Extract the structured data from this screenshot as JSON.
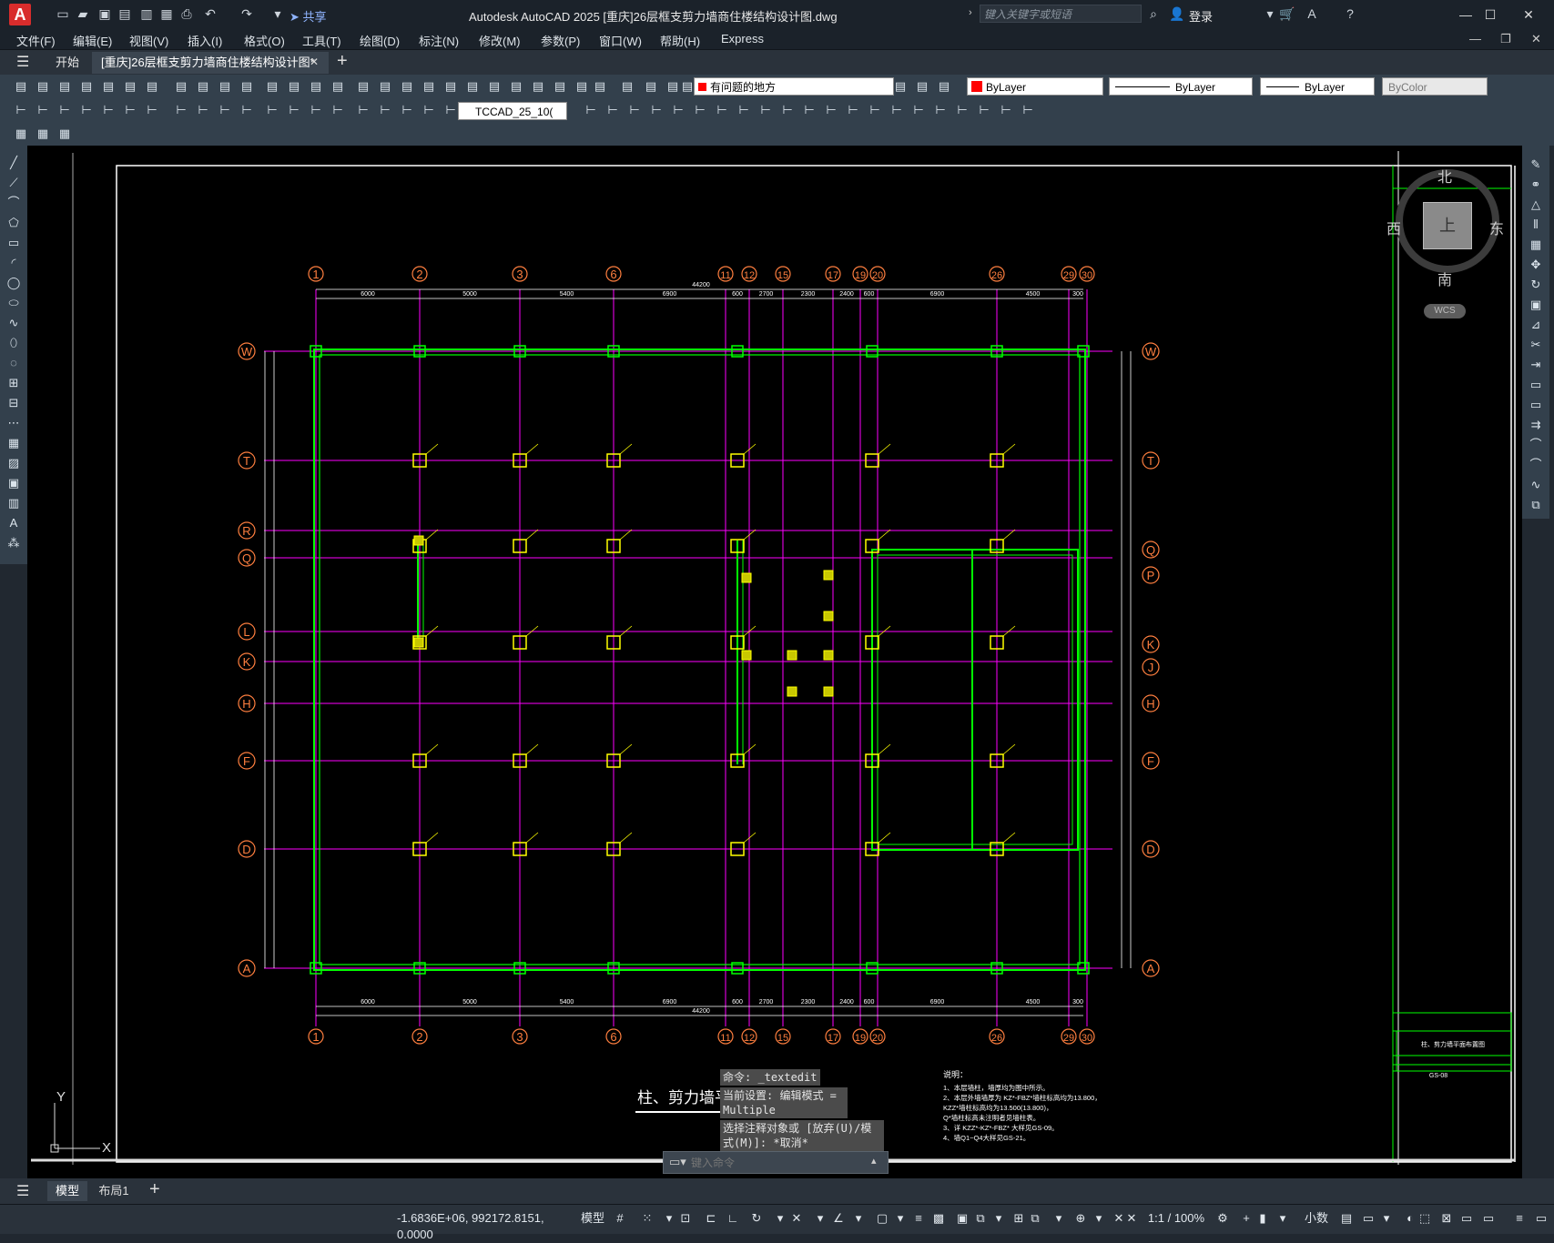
{
  "app": {
    "title": "Autodesk AutoCAD 2025    [重庆]26层框支剪力墙商住楼结构设计图.dwg",
    "logo": "A",
    "search_placeholder": "键入关键字或短语",
    "login": "登录",
    "share": "共享"
  },
  "menu": [
    "文件(F)",
    "编辑(E)",
    "视图(V)",
    "插入(I)",
    "格式(O)",
    "工具(T)",
    "绘图(D)",
    "标注(N)",
    "修改(M)",
    "参数(P)",
    "窗口(W)",
    "帮助(H)",
    "Express"
  ],
  "tabs": {
    "start": "开始",
    "document": "[重庆]26层框支剪力墙商住楼结构设计图*"
  },
  "toolbar": {
    "layer": "有问题的地方",
    "color": "ByLayer",
    "linetype": "ByLayer",
    "lineweight": "ByLayer",
    "plotstyle": "ByColor",
    "textstyle": "TCCAD_25_10("
  },
  "viewcube": {
    "north": "北",
    "south": "南",
    "east": "东",
    "west": "西",
    "top": "上",
    "wcs": "WCS"
  },
  "drawing": {
    "top_axes": [
      "1",
      "2",
      "3",
      "6",
      "11",
      "12",
      "15",
      "17",
      "19",
      "20",
      "26",
      "29",
      "30"
    ],
    "left_axes": [
      "W",
      "T",
      "R",
      "Q",
      "L",
      "K",
      "H",
      "F",
      "D",
      "A"
    ],
    "right_axes": [
      "W",
      "T",
      "Q",
      "P",
      "K",
      "J",
      "H",
      "F",
      "D",
      "A"
    ],
    "overall_dim": "44200",
    "top_dims": [
      "6000",
      "5000",
      "5400",
      "6900",
      "600",
      "2700",
      "2300",
      "2400",
      "600",
      "6900",
      "4500",
      "300"
    ],
    "plan_title": "柱、剪力墙平面布置图",
    "notes_title": "说明：",
    "notes": [
      "1、本层墙柱，墙厚均为图中所示。",
      "2、本层外墙墙厚为 KZ*-FBZ*墙柱标高均为13.800，",
      "    KZZ*墙柱标高均为13.500(13.800)，",
      "    Q*墙柱标高未注明者见墙柱表。",
      "3、详 KZZ*-KZ*-FBZ* 大样见GS-09。",
      "4、墙Q1~Q4大样见GS-21。"
    ],
    "titleblock_name": "柱、剪力墙平面布置图",
    "titleblock_no": "GS-08"
  },
  "command": {
    "line1": "命令: _textedit",
    "line2": "当前设置: 编辑模式 = Multiple",
    "line3": "选择注释对象或 [放弃(U)/模式(M)]: *取消*",
    "input_placeholder": "键入命令"
  },
  "layout_tabs": [
    "模型",
    "布局1"
  ],
  "status": {
    "coords": "-1.6836E+06, 992172.8151, 0.0000",
    "mode": "模型",
    "scale": "1:1 / 100%",
    "units": "小数"
  },
  "colors": {
    "grid": "#ff00ff",
    "wall": "#00ff00",
    "column": "#ffff00",
    "bubble": "#ff7f3f",
    "dim": "#ffffff"
  }
}
